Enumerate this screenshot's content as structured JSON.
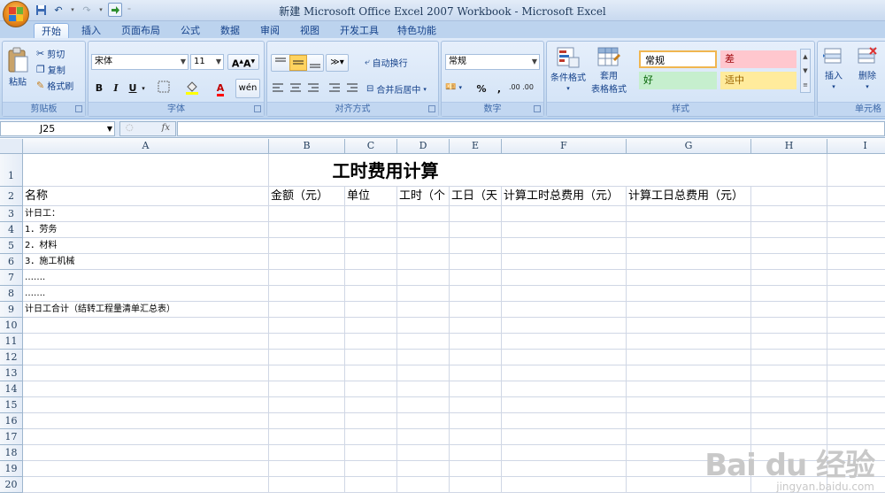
{
  "window": {
    "title": "新建 Microsoft Office Excel 2007 Workbook - Microsoft Excel"
  },
  "tabs": [
    "开始",
    "插入",
    "页面布局",
    "公式",
    "数据",
    "审阅",
    "视图",
    "开发工具",
    "特色功能"
  ],
  "ribbon": {
    "clipboard": {
      "paste": "粘贴",
      "cut": "剪切",
      "copy": "复制",
      "format_painter": "格式刷",
      "label": "剪贴板"
    },
    "font": {
      "name": "宋体",
      "size": "11",
      "bold": "B",
      "italic": "I",
      "underline": "U",
      "label": "字体"
    },
    "alignment": {
      "wrap": "自动换行",
      "merge": "合并后居中",
      "label": "对齐方式"
    },
    "number": {
      "format": "常规",
      "percent": "%",
      "comma": ",",
      "label": "数字"
    },
    "styles": {
      "conditional": "条件格式",
      "table_fmt_1": "套用",
      "table_fmt_2": "表格格式",
      "normal": "常规",
      "bad": "差",
      "good": "好",
      "neutral": "适中",
      "label": "样式"
    },
    "cells": {
      "insert": "插入",
      "delete": "删除",
      "label": "单元格"
    }
  },
  "formula_bar": {
    "name_box": "J25",
    "fx": "fx",
    "content": ""
  },
  "columns": [
    "A",
    "B",
    "C",
    "D",
    "E",
    "F",
    "G",
    "H",
    "I"
  ],
  "rows": [
    "1",
    "2",
    "3",
    "4",
    "5",
    "6",
    "7",
    "8",
    "9",
    "10",
    "11",
    "12",
    "13",
    "14",
    "15",
    "16",
    "17",
    "18",
    "19",
    "20"
  ],
  "sheet": {
    "title": "工时费用计算",
    "headers": [
      "名称",
      "金额（元）",
      "单位",
      "工时（个",
      "工日（天",
      "计算工时总费用（元）",
      "计算工日总费用（元）"
    ],
    "col_a": [
      "计日工：",
      "1．劳务",
      "2．材料",
      "3．施工机械",
      "…….",
      "…….",
      "计日工合计（结转工程量清单汇总表）"
    ]
  },
  "watermark": {
    "main": "Bai du 经验",
    "sub": "jingyan.baidu.com"
  },
  "colors": {
    "bad_bg": "#ffc7ce",
    "bad_fg": "#9c0006",
    "good_bg": "#c6efce",
    "good_fg": "#006100",
    "neutral_bg": "#ffeb9c",
    "neutral_fg": "#9c6500"
  }
}
